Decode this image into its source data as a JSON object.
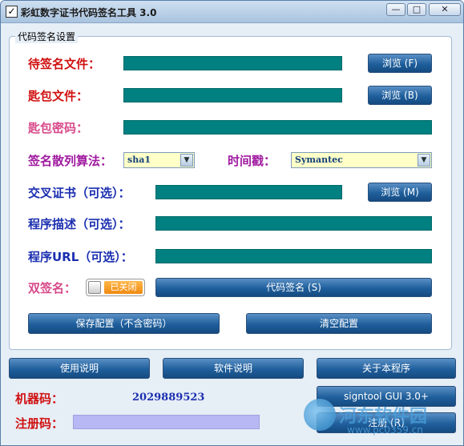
{
  "window": {
    "title": "彩虹数字证书代码签名工具 3.0",
    "minimize": "—",
    "maximize": "□",
    "close": "✕"
  },
  "group": {
    "title": "代码签名设置"
  },
  "form": {
    "sign_file_label": "待签名文件：",
    "browse_f": "浏览 (F)",
    "key_file_label": "匙包文件：",
    "browse_b": "浏览 (B)",
    "key_password_label": "匙包密码：",
    "hash_label": "签名散列算法：",
    "hash_value": "sha1",
    "timestamp_label": "时间戳：",
    "timestamp_value": "Symantec",
    "cross_cert_label": "交叉证书（可选）：",
    "browse_m": "浏览 (M)",
    "desc_label": "程序描述（可选）：",
    "url_label": "程序URL（可选）：",
    "dual_sign_label": "双签名：",
    "dual_sign_state": "已关闭",
    "code_sign_button": "代码签名 (S)",
    "save_config_button": "保存配置（不含密码）",
    "clear_config_button": "清空配置"
  },
  "bottom": {
    "usage_button": "使用说明",
    "software_button": "软件说明",
    "about_button": "关于本程序",
    "machine_code_label": "机器码：",
    "machine_code_value": "2029889523",
    "signtool_button": "signtool GUI 3.0+",
    "register_label": "注册码：",
    "register_button": "注册 (R)"
  },
  "watermark": {
    "text": "河东软件园",
    "url": "www.pc0359.cn"
  },
  "colors": {
    "field_teal": "#008080",
    "button_blue": "#1f5f9c",
    "label_red": "#d01010",
    "label_blue": "#1b2fb0",
    "label_purple": "#a01aa0",
    "label_pink": "#d84a8a",
    "toggle_orange": "#f08a10"
  }
}
